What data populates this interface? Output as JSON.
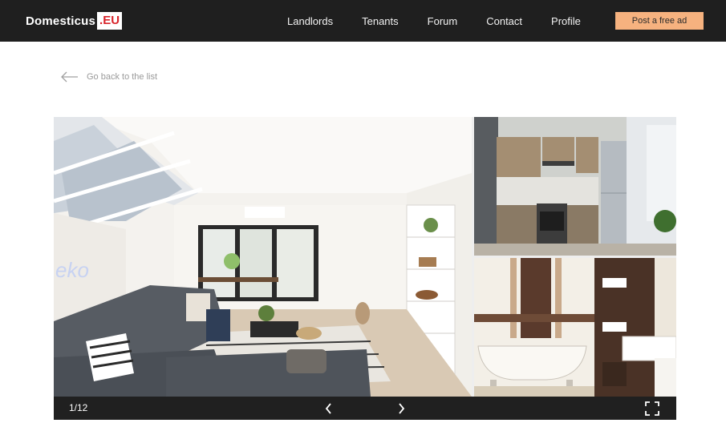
{
  "header": {
    "logo_text": "Domesticus",
    "logo_badge": ".EU",
    "nav": [
      "Landlords",
      "Tenants",
      "Forum",
      "Contact",
      "Profile"
    ],
    "post_button": "Post a free ad"
  },
  "back_link": {
    "label": "Go back to the list",
    "icon": "arrow-left-icon"
  },
  "gallery": {
    "counter": "1/12",
    "prev_icon": "chevron-left-icon",
    "next_icon": "chevron-right-icon",
    "fullscreen_icon": "fullscreen-icon",
    "photos": [
      "living-room",
      "kitchen",
      "bathroom"
    ],
    "wall_sign": "eko"
  },
  "colors": {
    "header_bg": "#1f1f1f",
    "accent": "#f6b27f",
    "badge_text": "#d8232a"
  }
}
